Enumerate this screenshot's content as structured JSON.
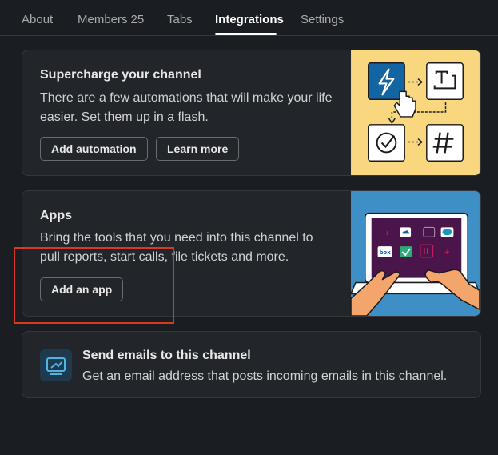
{
  "tabs": [
    {
      "label": "About",
      "count": ""
    },
    {
      "label": "Members",
      "count": "25"
    },
    {
      "label": "Tabs",
      "count": ""
    },
    {
      "label": "Integrations",
      "count": ""
    },
    {
      "label": "Settings",
      "count": ""
    }
  ],
  "active_tab": "Integrations",
  "automations": {
    "title": "Supercharge your channel",
    "description": "There are a few automations that will make your life easier. Set them up in a flash.",
    "add_button": "Add automation",
    "learn_button": "Learn more"
  },
  "apps": {
    "title": "Apps",
    "description": "Bring the tools that you need into this channel to pull reports, start calls, file tickets and more.",
    "add_button": "Add an app",
    "logos": [
      "box"
    ]
  },
  "emails": {
    "title": "Send emails to this channel",
    "description": "Get an email address that posts incoming emails in this channel."
  },
  "colors": {
    "background": "#1a1d21",
    "card": "#222529",
    "accent_blue": "#1264a3",
    "automation_bg": "#f8d77f",
    "apps_bg": "#3e8fc6",
    "highlight": "#d93a1f"
  }
}
